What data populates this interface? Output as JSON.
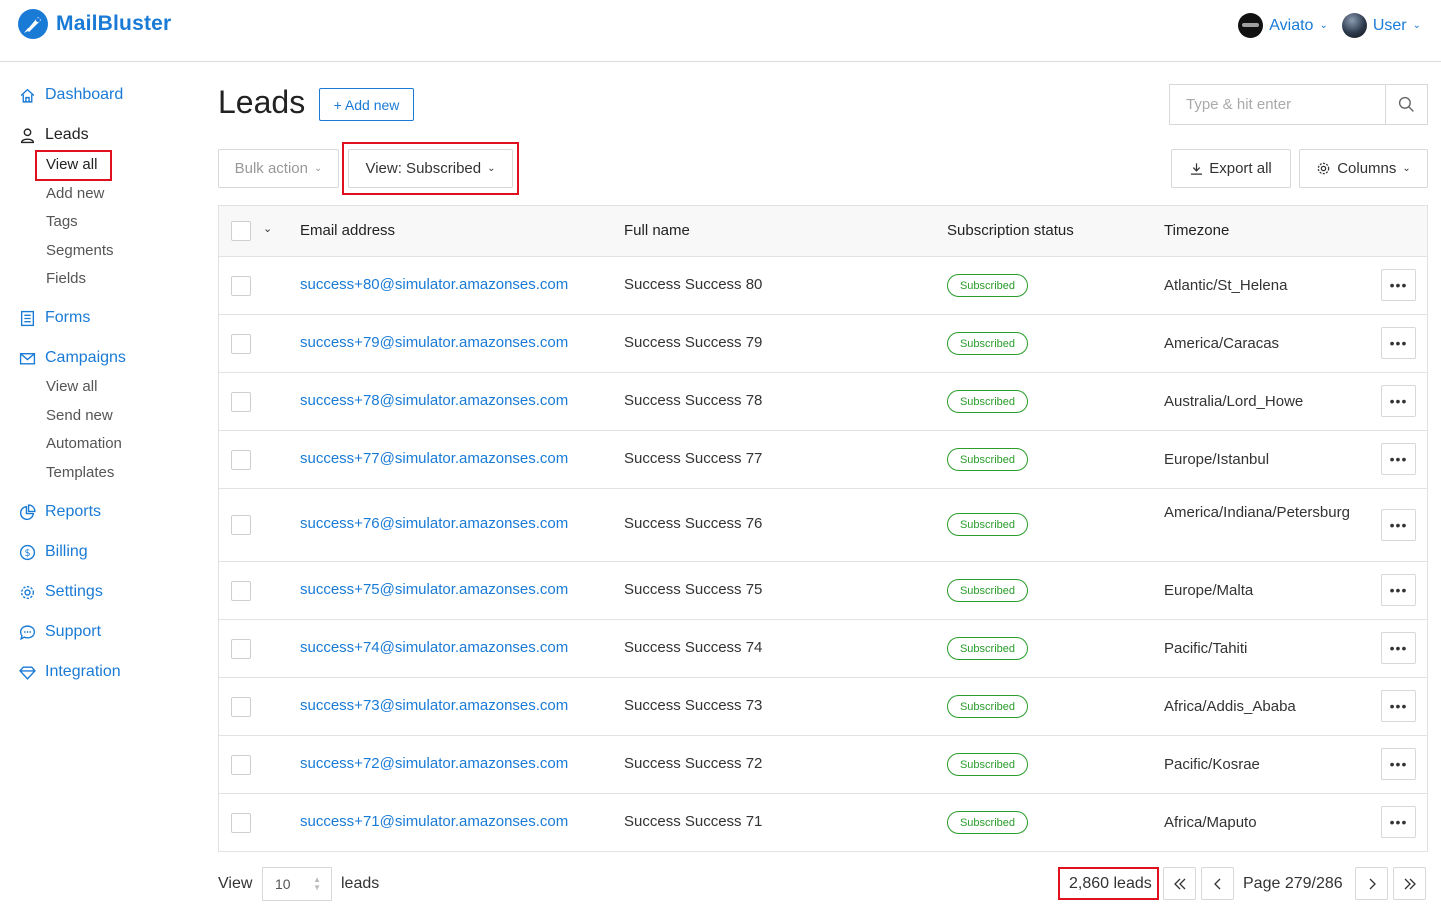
{
  "header": {
    "brand": "MailBluster",
    "org": "Aviato",
    "user": "User"
  },
  "sidebar": {
    "dashboard": "Dashboard",
    "leads": "Leads",
    "leads_sub": [
      "View all",
      "Add new",
      "Tags",
      "Segments",
      "Fields"
    ],
    "forms": "Forms",
    "campaigns": "Campaigns",
    "campaigns_sub": [
      "View all",
      "Send new",
      "Automation",
      "Templates"
    ],
    "reports": "Reports",
    "billing": "Billing",
    "settings": "Settings",
    "support": "Support",
    "integration": "Integration"
  },
  "main": {
    "title": "Leads",
    "add_new": "+ Add new",
    "search_placeholder": "Type & hit enter",
    "bulk_action": "Bulk action",
    "view_filter": "View: Subscribed",
    "export_all": "Export all",
    "columns": "Columns"
  },
  "table": {
    "headers": [
      "Email address",
      "Full name",
      "Subscription status",
      "Timezone"
    ],
    "rows": [
      {
        "email": "success+80@simulator.amazonses.com",
        "name": "Success Success 80",
        "status": "Subscribed",
        "timezone": "Atlantic/St_Helena"
      },
      {
        "email": "success+79@simulator.amazonses.com",
        "name": "Success Success 79",
        "status": "Subscribed",
        "timezone": "America/Caracas"
      },
      {
        "email": "success+78@simulator.amazonses.com",
        "name": "Success Success 78",
        "status": "Subscribed",
        "timezone": "Australia/Lord_Howe"
      },
      {
        "email": "success+77@simulator.amazonses.com",
        "name": "Success Success 77",
        "status": "Subscribed",
        "timezone": "Europe/Istanbul"
      },
      {
        "email": "success+76@simulator.amazonses.com",
        "name": "Success Success 76",
        "status": "Subscribed",
        "timezone": "America/Indiana/Petersburg"
      },
      {
        "email": "success+75@simulator.amazonses.com",
        "name": "Success Success 75",
        "status": "Subscribed",
        "timezone": "Europe/Malta"
      },
      {
        "email": "success+74@simulator.amazonses.com",
        "name": "Success Success 74",
        "status": "Subscribed",
        "timezone": "Pacific/Tahiti"
      },
      {
        "email": "success+73@simulator.amazonses.com",
        "name": "Success Success 73",
        "status": "Subscribed",
        "timezone": "Africa/Addis_Ababa"
      },
      {
        "email": "success+72@simulator.amazonses.com",
        "name": "Success Success 72",
        "status": "Subscribed",
        "timezone": "Pacific/Kosrae"
      },
      {
        "email": "success+71@simulator.amazonses.com",
        "name": "Success Success 71",
        "status": "Subscribed",
        "timezone": "Africa/Maputo"
      }
    ]
  },
  "footer": {
    "view_label": "View",
    "per_page": "10",
    "leads_label": "leads",
    "total": "2,860 leads",
    "page": "Page 279/286"
  },
  "colors": {
    "accent": "#1a7bd6",
    "status_green": "#2a9d2a",
    "highlight_red": "#e0101c"
  }
}
